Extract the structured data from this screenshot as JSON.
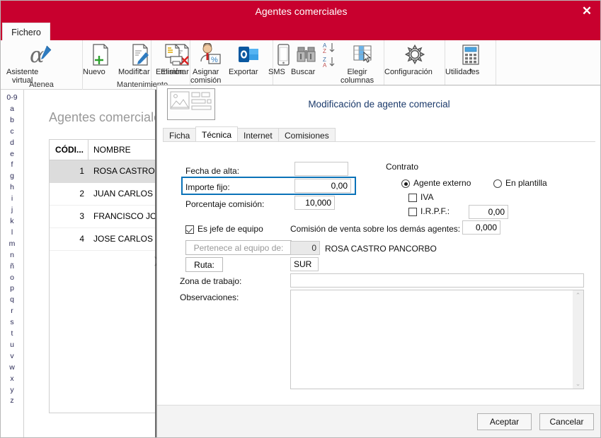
{
  "window": {
    "title": "Agentes comerciales",
    "close_label": "✕",
    "accent_color": "#C8002E"
  },
  "ribbon": {
    "tab_label": "Fichero",
    "groups": [
      {
        "label": "Atenea",
        "items": [
          {
            "label": "Asistente\nvirtual",
            "icon": "alpha-pen-icon",
            "caret": false
          }
        ]
      },
      {
        "label": "Mantenimiento",
        "items": [
          {
            "label": "Nuevo",
            "icon": "new-document-icon",
            "caret": false
          },
          {
            "label": "Modificar",
            "icon": "edit-document-icon",
            "caret": true
          },
          {
            "label": "Eliminar",
            "icon": "delete-document-icon",
            "caret": false
          }
        ]
      },
      {
        "label": "",
        "items": [
          {
            "label": "Emisión",
            "icon": "print-document-icon",
            "caret": false
          }
        ]
      },
      {
        "label": "",
        "items": [
          {
            "label": "Asignar\ncomisión",
            "icon": "assign-commission-icon",
            "caret": false
          },
          {
            "label": "Exportar",
            "icon": "outlook-export-icon",
            "caret": false
          },
          {
            "label": "SMS",
            "icon": "mobile-sms-icon",
            "caret": false
          }
        ]
      },
      {
        "label": "",
        "items": [
          {
            "label": "Buscar",
            "icon": "binoculars-search-icon",
            "caret": false
          },
          {
            "label": "Elegir\ncolumnas",
            "icon": "choose-columns-icon",
            "caret": false
          }
        ]
      },
      {
        "label": "",
        "items": [
          {
            "label": "Configuración",
            "icon": "gear-icon",
            "caret": false
          }
        ]
      },
      {
        "label": "",
        "items": [
          {
            "label": "Utilidades",
            "icon": "calculator-icon",
            "caret": true
          }
        ]
      }
    ]
  },
  "alphabet": [
    "0-9",
    "a",
    "b",
    "c",
    "d",
    "e",
    "f",
    "g",
    "h",
    "i",
    "j",
    "k",
    "l",
    "m",
    "n",
    "ñ",
    "o",
    "p",
    "q",
    "r",
    "s",
    "t",
    "u",
    "v",
    "w",
    "x",
    "y",
    "z"
  ],
  "list": {
    "title": "Agentes comerciales",
    "columns": [
      "CÓDI...",
      "NOMBRE"
    ],
    "rows": [
      {
        "code": "1",
        "name": "ROSA CASTRO PANCORBO",
        "selected": true
      },
      {
        "code": "2",
        "name": "JUAN CARLOS RO",
        "selected": false
      },
      {
        "code": "3",
        "name": "FRANCISCO JOSE",
        "selected": false
      },
      {
        "code": "4",
        "name": "JOSE CARLOS RU",
        "selected": false
      }
    ],
    "splitter_arrow": "❯"
  },
  "dialog": {
    "title": "Modificación de agente comercial",
    "tabs": [
      {
        "label": "Ficha",
        "active": false
      },
      {
        "label": "Técnica",
        "active": true
      },
      {
        "label": "Internet",
        "active": false
      },
      {
        "label": "Comisiones",
        "active": false
      }
    ],
    "fields": {
      "fecha_alta_label": "Fecha de alta:",
      "fecha_alta_value": "",
      "importe_fijo_label": "Importe fijo:",
      "importe_fijo_value": "0,00",
      "porcentaje_comision_label": "Porcentaje comisión:",
      "porcentaje_comision_value": "10,000",
      "es_jefe_label": "Es jefe de equipo",
      "es_jefe_checked": true,
      "pertenece_button": "Pertenece al equipo de:",
      "ruta_button": "Ruta:",
      "ruta_value": "SUR",
      "zona_label": "Zona de trabajo:",
      "zona_value": "",
      "observaciones_label": "Observaciones:",
      "observaciones_value": ""
    },
    "contrato": {
      "group_label": "Contrato",
      "agente_externo_label": "Agente externo",
      "agente_externo_selected": true,
      "en_plantilla_label": "En plantilla",
      "en_plantilla_selected": false,
      "iva_label": "IVA",
      "iva_checked": false,
      "irpf_label": "I.R.P.F.:",
      "irpf_checked": false,
      "irpf_value": "0,00"
    },
    "comision_demas": {
      "label": "Comisión de venta sobre los demás agentes:",
      "value": "0,000",
      "equipo_code": "0",
      "equipo_name": "ROSA CASTRO PANCORBO"
    },
    "scrollbar": {
      "up": "⌃",
      "down": "⌄"
    },
    "buttons": {
      "accept": "Aceptar",
      "cancel": "Cancelar"
    },
    "highlight_color": "#0a72b8"
  }
}
